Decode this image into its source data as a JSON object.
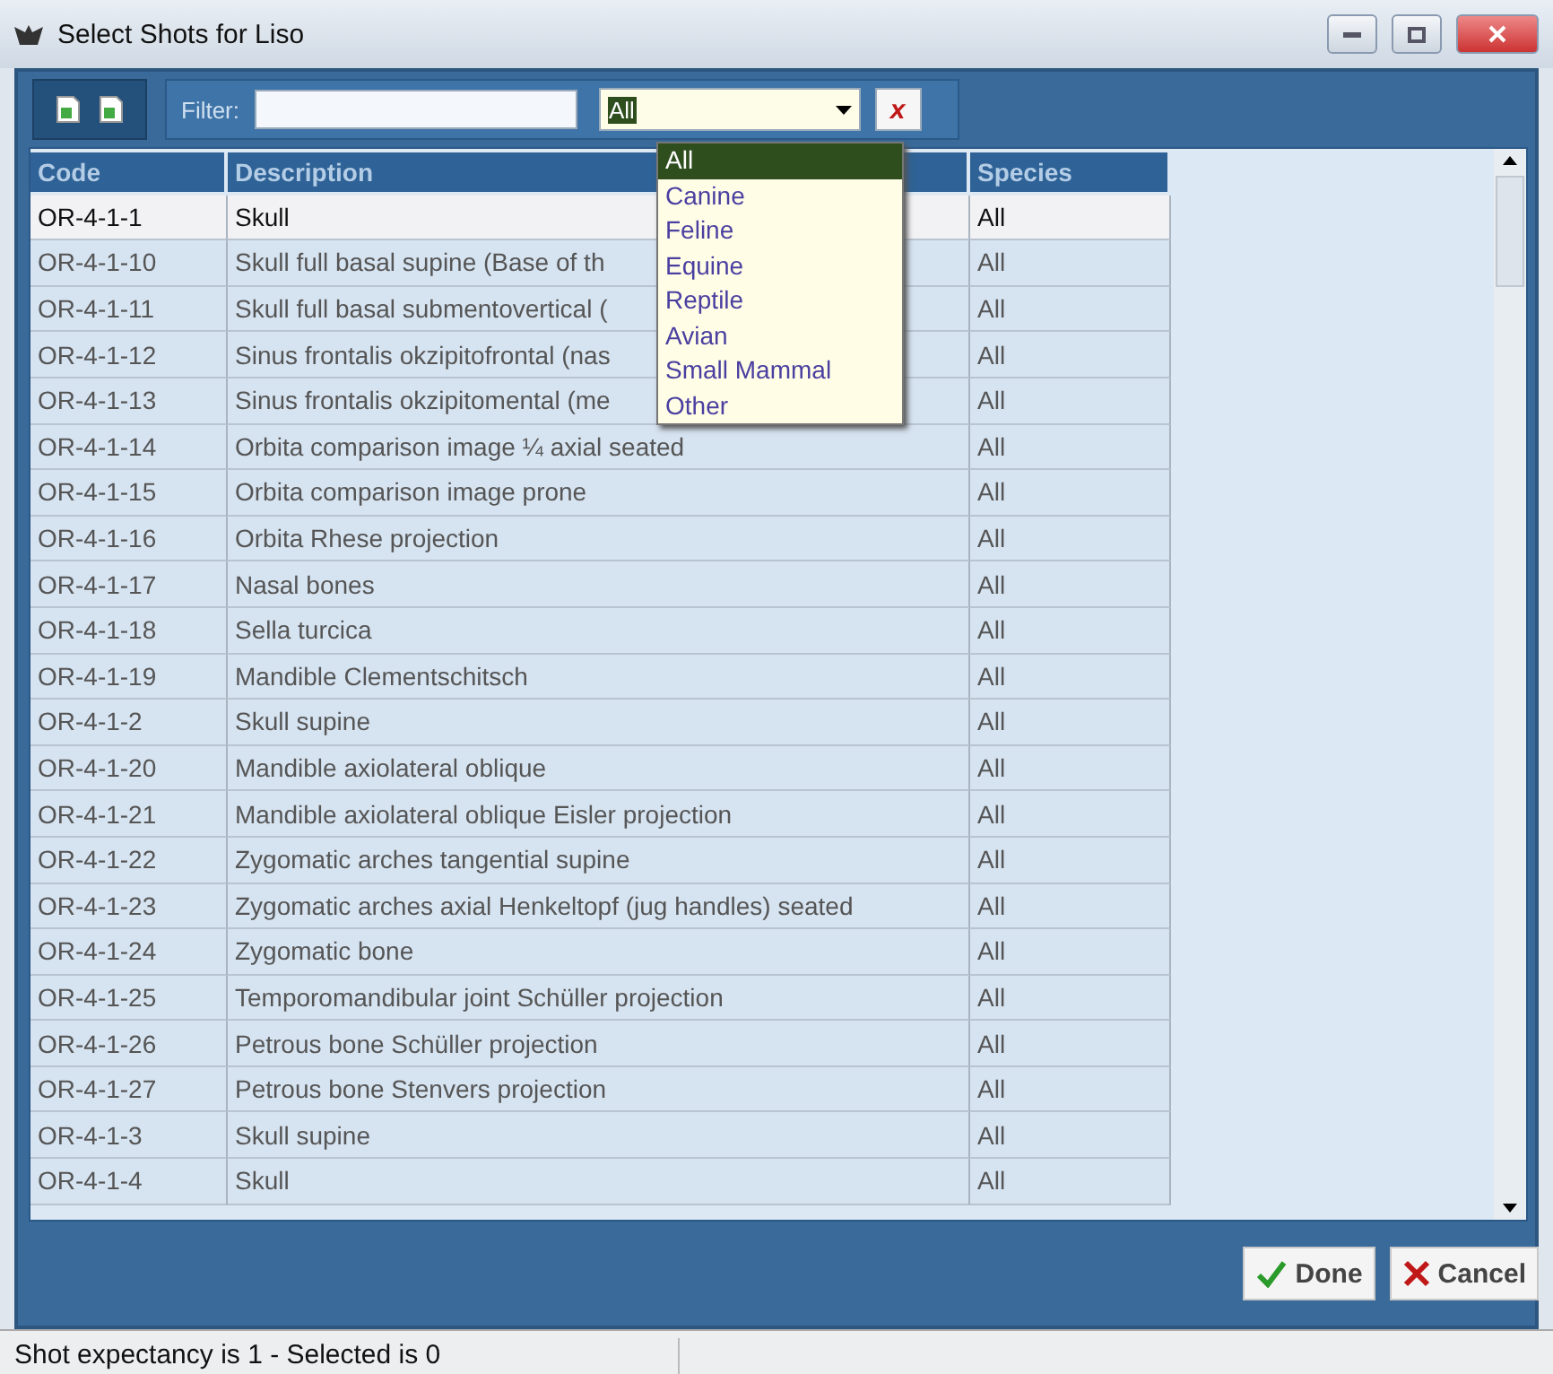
{
  "window": {
    "title": "Select Shots for Liso"
  },
  "toolbar": {
    "filter_label": "Filter:",
    "species_value": "All",
    "clear_button": "x"
  },
  "dropdown": {
    "options": [
      {
        "label": "All",
        "selected": true
      },
      {
        "label": "Canine",
        "selected": false
      },
      {
        "label": "Feline",
        "selected": false
      },
      {
        "label": "Equine",
        "selected": false
      },
      {
        "label": "Reptile",
        "selected": false
      },
      {
        "label": "Avian",
        "selected": false
      },
      {
        "label": "Small Mammal",
        "selected": false
      },
      {
        "label": "Other",
        "selected": false
      }
    ]
  },
  "table": {
    "columns": [
      "Code",
      "Description",
      "Species"
    ],
    "rows": [
      {
        "code": "OR-4-1-1",
        "description": "Skull",
        "species": "All",
        "selected": true
      },
      {
        "code": "OR-4-1-10",
        "description": "Skull full basal supine (Base of th",
        "species": "All",
        "selected": false
      },
      {
        "code": "OR-4-1-11",
        "description": "Skull full basal submentovertical (",
        "species": "All",
        "selected": false
      },
      {
        "code": "OR-4-1-12",
        "description": "Sinus frontalis okzipitofrontal (nas",
        "species": "All",
        "selected": false
      },
      {
        "code": "OR-4-1-13",
        "description": "Sinus frontalis okzipitomental (me",
        "species": "All",
        "selected": false
      },
      {
        "code": "OR-4-1-14",
        "description": "Orbita comparison image ¼ axial seated",
        "species": "All",
        "selected": false
      },
      {
        "code": "OR-4-1-15",
        "description": "Orbita comparison image prone",
        "species": "All",
        "selected": false
      },
      {
        "code": "OR-4-1-16",
        "description": "Orbita Rhese projection",
        "species": "All",
        "selected": false
      },
      {
        "code": "OR-4-1-17",
        "description": "Nasal bones",
        "species": "All",
        "selected": false
      },
      {
        "code": "OR-4-1-18",
        "description": "Sella turcica",
        "species": "All",
        "selected": false
      },
      {
        "code": "OR-4-1-19",
        "description": "Mandible Clementschitsch",
        "species": "All",
        "selected": false
      },
      {
        "code": "OR-4-1-2",
        "description": "Skull supine",
        "species": "All",
        "selected": false
      },
      {
        "code": "OR-4-1-20",
        "description": "Mandible axiolateral oblique",
        "species": "All",
        "selected": false
      },
      {
        "code": "OR-4-1-21",
        "description": "Mandible axiolateral oblique Eisler projection",
        "species": "All",
        "selected": false
      },
      {
        "code": "OR-4-1-22",
        "description": "Zygomatic arches tangential supine",
        "species": "All",
        "selected": false
      },
      {
        "code": "OR-4-1-23",
        "description": "Zygomatic arches axial Henkeltopf (jug handles) seated",
        "species": "All",
        "selected": false
      },
      {
        "code": "OR-4-1-24",
        "description": "Zygomatic bone",
        "species": "All",
        "selected": false
      },
      {
        "code": "OR-4-1-25",
        "description": "Temporomandibular joint Schüller projection",
        "species": "All",
        "selected": false
      },
      {
        "code": "OR-4-1-26",
        "description": "Petrous bone Schüller projection",
        "species": "All",
        "selected": false
      },
      {
        "code": "OR-4-1-27",
        "description": "Petrous bone Stenvers projection",
        "species": "All",
        "selected": false
      },
      {
        "code": "OR-4-1-3",
        "description": "Skull supine",
        "species": "All",
        "selected": false
      },
      {
        "code": "OR-4-1-4",
        "description": "Skull",
        "species": "All",
        "selected": false
      }
    ]
  },
  "buttons": [
    "Done",
    "Cancel"
  ],
  "status_bar": "Shot expectancy is 1 - Selected is 0"
}
